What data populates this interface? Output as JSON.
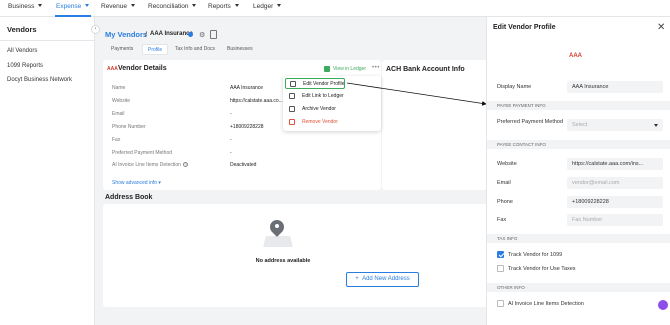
{
  "topnav": {
    "items": [
      "Business",
      "Expense",
      "Revenue",
      "Reconciliation",
      "Reports",
      "Ledger"
    ],
    "active": "Expense"
  },
  "sidebar": {
    "title": "Vendors",
    "items": [
      "All Vendors",
      "1099 Reports",
      "Docyt Business Network"
    ]
  },
  "breadcrumb": {
    "link": "My Vendors",
    "separator": "/",
    "vendor": "AAA Insurance"
  },
  "tabs": [
    "Payments",
    "Profile",
    "Tax Info and Docs",
    "Businesses"
  ],
  "active_tab": "Profile",
  "vendor_details": {
    "title": "Vendor Details",
    "logo_text": "AAA",
    "ledger_label": "View in Ledger",
    "fields": [
      {
        "label": "Name",
        "value": "AAA Insurance"
      },
      {
        "label": "Website",
        "value": "https://calstate.aaa.co..."
      },
      {
        "label": "Email",
        "value": "-"
      },
      {
        "label": "Phone Number",
        "value": "+18009228228"
      },
      {
        "label": "Fax",
        "value": "-"
      },
      {
        "label": "Preferred Payment Method",
        "value": "-"
      },
      {
        "label": "AI Invoice Line Items Detection",
        "value": "Deactivated"
      }
    ],
    "show_advanced": "Show advanced info"
  },
  "menu": {
    "items": [
      "Edit Vendor Profile",
      "Edit Link to Ledger",
      "Archive Vendor",
      "Remove Vendor"
    ]
  },
  "ach": {
    "title": "ACH Bank Account Info"
  },
  "address_book": {
    "title": "Address Book",
    "empty_text": "No address available",
    "add_button": "Add New Address"
  },
  "panel": {
    "title": "Edit Vendor Profile",
    "logo_text": "AAA",
    "display_name_label": "Display Name",
    "display_name_value": "AAA Insurance",
    "sections": {
      "payee_payment": "PAYEE PAYMENT INFO",
      "payee_contact": "PAYEE CONTACT INFO",
      "tax": "TAX INFO",
      "other": "OTHER INFO"
    },
    "preferred_method_label": "Preferred Payment Method",
    "preferred_method_placeholder": "Select",
    "website_label": "Website",
    "website_value": "https://calstate.aaa.com/ins...",
    "email_label": "Email",
    "email_placeholder": "vendor@email.com",
    "phone_label": "Phone",
    "phone_value": "+18009228228",
    "fax_label": "Fax",
    "fax_placeholder": "Fax Number",
    "track_1099_label": "Track Vendor for 1099",
    "track_use_tax_label": "Track Vendor for Use Taxes",
    "ai_detection_label": "AI Invoice Line Items Detection"
  },
  "colors": {
    "accent": "#2a7de1",
    "ledger_green": "#3cab5b",
    "danger": "#e0523b"
  }
}
